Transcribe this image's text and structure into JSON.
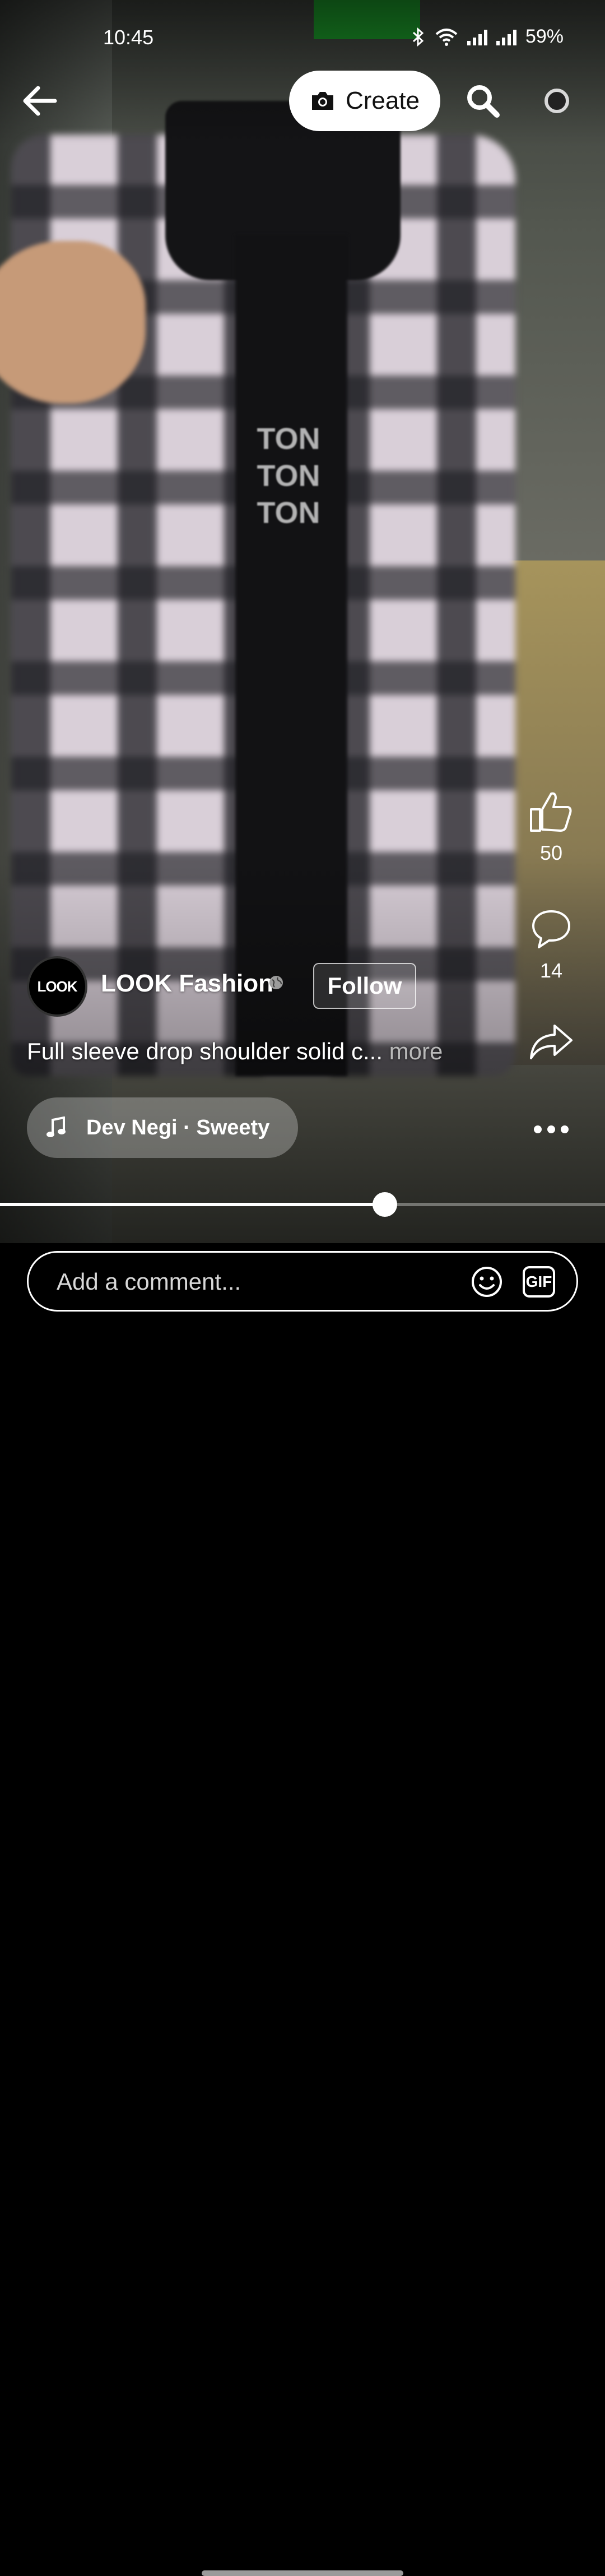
{
  "status_bar": {
    "time": "10:45",
    "battery": "59%",
    "icons": [
      "bluetooth-icon",
      "wifi-icon",
      "signal-icon",
      "signal-icon"
    ]
  },
  "top_bar": {
    "back_icon": "arrow-left-icon",
    "create_label": "Create",
    "create_icon": "camera-icon",
    "search_icon": "search-icon",
    "profile_icon": "profile-ring-icon"
  },
  "actions": {
    "like_count": "50",
    "comment_count": "14",
    "share_icon": "share-icon",
    "more_icon": "more-horizontal-icon"
  },
  "post": {
    "page_name": "LOOK Fashion",
    "avatar_text": "LOOK",
    "privacy_icon": "globe-icon",
    "follow_label": "Follow",
    "caption": "Full sleeve drop shoulder solid c...",
    "more_label": "more",
    "music_icon": "music-note-icon",
    "music_text": "Dev Negi · Sweety"
  },
  "video": {
    "progress_fraction": 0.636
  },
  "comment": {
    "placeholder": "Add a comment...",
    "emoji_icon": "emoji-icon",
    "gif_label": "GIF"
  },
  "colors": {
    "background": "#000000",
    "create_button_bg": "#ffffff",
    "text": "#ffffff"
  }
}
